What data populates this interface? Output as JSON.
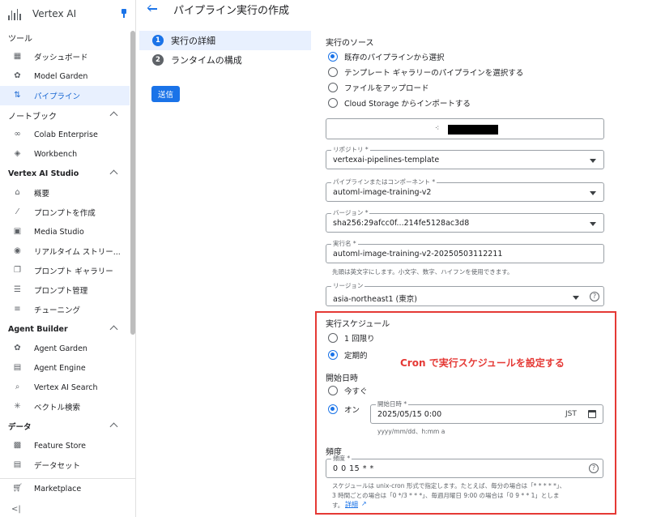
{
  "sidebar": {
    "app_title": "Vertex AI",
    "groups": [
      {
        "label": "ツール",
        "items": [
          {
            "label": "ダッシュボード",
            "icon": "dashboard-icon"
          },
          {
            "label": "Model Garden",
            "icon": "model-garden-icon"
          },
          {
            "label": "パイプライン",
            "icon": "pipeline-icon",
            "active": true
          }
        ]
      },
      {
        "label": "ノートブック",
        "items": [
          {
            "label": "Colab Enterprise",
            "icon": "colab-icon"
          },
          {
            "label": "Workbench",
            "icon": "workbench-icon"
          }
        ]
      },
      {
        "label": "Vertex AI Studio",
        "items": [
          {
            "label": "概要",
            "icon": "home-icon"
          },
          {
            "label": "プロンプトを作成",
            "icon": "magic-wand-icon"
          },
          {
            "label": "Media Studio",
            "icon": "media-icon"
          },
          {
            "label": "リアルタイム ストリー...",
            "icon": "stream-icon"
          },
          {
            "label": "プロンプト ギャラリー",
            "icon": "gallery-icon"
          },
          {
            "label": "プロンプト管理",
            "icon": "list-icon"
          },
          {
            "label": "チューニング",
            "icon": "tune-icon"
          }
        ]
      },
      {
        "label": "Agent Builder",
        "items": [
          {
            "label": "Agent Garden",
            "icon": "agent-garden-icon"
          },
          {
            "label": "Agent Engine",
            "icon": "agent-engine-icon"
          },
          {
            "label": "Vertex AI Search",
            "icon": "search-icon"
          },
          {
            "label": "ベクトル検索",
            "icon": "vector-icon"
          }
        ]
      },
      {
        "label": "データ",
        "items": [
          {
            "label": "Feature Store",
            "icon": "feature-store-icon"
          },
          {
            "label": "データセット",
            "icon": "dataset-icon"
          }
        ]
      }
    ],
    "marketplace": "Marketplace",
    "collapse": "<|"
  },
  "header": {
    "title": "パイプライン実行の作成"
  },
  "steps": [
    {
      "num": "1",
      "label": "実行の詳細",
      "active": true
    },
    {
      "num": "2",
      "label": "ランタイムの構成"
    }
  ],
  "submit_label": "送信",
  "source": {
    "label": "実行のソース",
    "options": [
      "既存のパイプラインから選択",
      "テンプレート ギャラリーのパイプラインを選択する",
      "ファイルをアップロード",
      "Cloud Storage からインポートする"
    ],
    "selected_index": 0
  },
  "repository": {
    "label": "リポジトリ *",
    "value": "vertexai-pipelines-template"
  },
  "pipeline": {
    "label": "パイプラインまたはコンポーネント *",
    "value": "automl-image-training-v2"
  },
  "version": {
    "label": "バージョン *",
    "value": "sha256:29afcc0f...214fe5128ac3d8"
  },
  "run_name": {
    "label": "実行名 *",
    "value": "automl-image-training-v2-20250503112211",
    "hint": "先頭は英文字にします。小文字、数字、ハイフンを使用できます。"
  },
  "region": {
    "label": "リージョン",
    "value": "asia-northeast1 (東京)"
  },
  "schedule": {
    "label": "実行スケジュール",
    "options": [
      "1 回限り",
      "定期的"
    ],
    "selected_index": 1
  },
  "start": {
    "label": "開始日時",
    "options": [
      "今すぐ",
      "オン"
    ],
    "selected_index": 1,
    "datetime_label": "開始日時 *",
    "datetime_value": "2025/05/15 0:00",
    "timezone": "JST",
    "format_hint": "yyyy/mm/dd、h:mm a"
  },
  "frequency": {
    "label": "頻度",
    "field_label": "頻度 *",
    "value": "0 0 15 * *",
    "help_line1": "スケジュールは unix-cron 形式で指定します。たとえば、毎分の場合は「* * * * *」、",
    "help_line2": "3 時間ごとの場合は「0 */3 * * *」、毎週月曜日 9:00 の場合は「0 9 * * 1」としま",
    "help_line3": "す。",
    "details_link": "詳細"
  },
  "annotation": "Cron で実行スケジュールを設定する",
  "colors": {
    "accent": "#1a73e8",
    "highlight": "#e53935"
  }
}
